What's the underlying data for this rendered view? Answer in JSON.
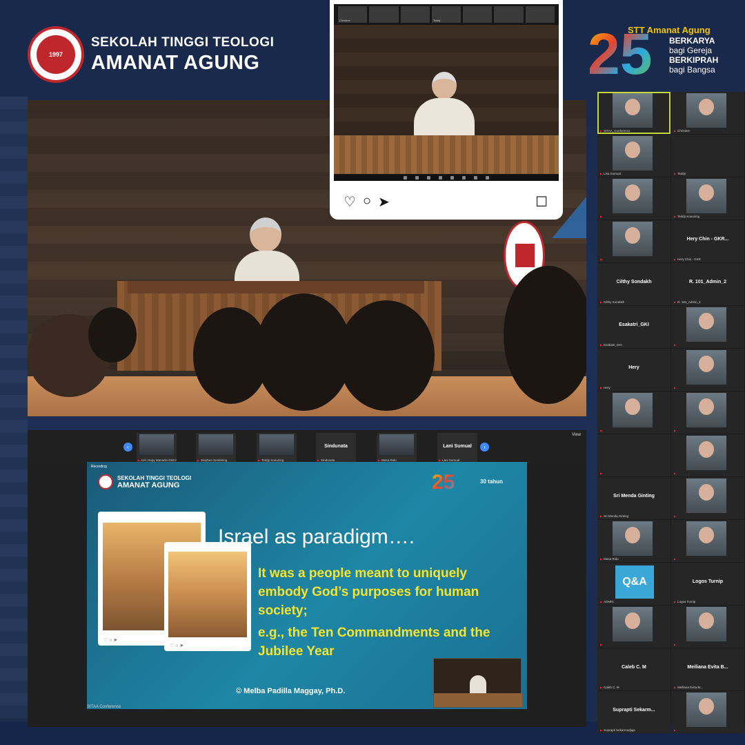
{
  "brand": {
    "line1": "SEKOLAH TINGGI TEOLOGI",
    "line2": "AMANAT AGUNG",
    "seal_year": "1997"
  },
  "anniversary": {
    "number": "25",
    "name": "STT Amanat Agung",
    "tag1": "BERKARYA",
    "tag2": "bagi Gereja",
    "tag3": "BERKIPRAH",
    "tag4": "bagi Bangsa"
  },
  "post_card": {
    "strip_names": [
      "Christine",
      "",
      "",
      "Teddy",
      "",
      "",
      ""
    ],
    "actions": {
      "like": "♡",
      "comment": "○",
      "share": "➤",
      "save": "☐"
    }
  },
  "gallery": [
    {
      "name": "",
      "tag": "SITAA_Conference",
      "video": true,
      "active": true
    },
    {
      "name": "",
      "tag": "Christine",
      "video": true
    },
    {
      "name": "",
      "tag": "Lisa Sumual",
      "video": true
    },
    {
      "name": "",
      "tag": "Teddy",
      "video": false
    },
    {
      "name": "",
      "tag": "",
      "video": true
    },
    {
      "name": "",
      "tag": "Teddy Koeuning",
      "video": true
    },
    {
      "name": "",
      "tag": "",
      "video": true
    },
    {
      "name": "Hery Chin - GKR...",
      "tag": "Hery Chin - GKR",
      "video": false
    },
    {
      "name": "Cilthy Sondakh",
      "tag": "Cilthy Sondakh",
      "video": false
    },
    {
      "name": "R. 101_Admin_2",
      "tag": "R. 101_Admin_2",
      "video": false
    },
    {
      "name": "Esakatri_GKI",
      "tag": "Esakatri_GKI",
      "video": false
    },
    {
      "name": "",
      "tag": "",
      "video": true
    },
    {
      "name": "Hery",
      "tag": "Hery",
      "video": false
    },
    {
      "name": "",
      "tag": "",
      "video": true
    },
    {
      "name": "",
      "tag": "",
      "video": true
    },
    {
      "name": "",
      "tag": "",
      "video": true
    },
    {
      "name": "",
      "tag": "",
      "video": false
    },
    {
      "name": "",
      "tag": "",
      "video": true
    },
    {
      "name": "Sri Menda Ginting",
      "tag": "Sri Menda Ginting",
      "video": false
    },
    {
      "name": "",
      "tag": "",
      "video": true
    },
    {
      "name": "",
      "tag": "Masa Rido",
      "video": true
    },
    {
      "name": "",
      "tag": "",
      "video": true
    },
    {
      "name": "",
      "tag": "ADMIN",
      "qa": "Q&A",
      "video": false
    },
    {
      "name": "Logos Turnip",
      "tag": "Logos Turnip",
      "video": false
    },
    {
      "name": "",
      "tag": "",
      "video": true
    },
    {
      "name": "",
      "tag": "",
      "video": true
    },
    {
      "name": "Caleb C. M",
      "tag": "Caleb C. M",
      "video": false
    },
    {
      "name": "Meiliana Evita B...",
      "tag": "Meiliana Evita Br...",
      "video": false
    },
    {
      "name": "Suprapti Sekarm...",
      "tag": "Suprapti Sekarmadjaja",
      "video": false
    },
    {
      "name": "",
      "tag": "",
      "video": true
    }
  ],
  "zoom_strip": [
    {
      "name": "",
      "tag": "Kel. Hepy Manacle-GMI N...",
      "video": true
    },
    {
      "name": "",
      "tag": "Stephen Sembiring",
      "video": true
    },
    {
      "name": "",
      "tag": "Teddy Koeuning",
      "video": true
    },
    {
      "name": "Sindunata",
      "tag": "Sindunata",
      "video": false
    },
    {
      "name": "",
      "tag": "Masa Rido",
      "video": true
    },
    {
      "name": "Lani Sumual",
      "tag": "Lani Sumual",
      "video": false
    }
  ],
  "zoom": {
    "view_label": "View",
    "conference": "SITAA Conference",
    "recording": "Recording",
    "prev": "‹",
    "next": "›"
  },
  "slide": {
    "brand1": "SEKOLAH TINGGI TEOLOGI",
    "brand2": "AMANAT AGUNG",
    "title": "Israel as paradigm….",
    "body": "It was a people meant to uniquely embody God’s purposes for human society;",
    "example": "e.g., the Ten Commandments and the Jubilee Year",
    "credit": "© Melba Padilla Maggay, Ph.D.",
    "logo_text": "30 tahun",
    "post_icons": "♡ ○ ➤"
  },
  "colors": {
    "accent": "#f5e52c",
    "brand_red": "#c0272d",
    "zoom_blue": "#3d8bfd",
    "active_border": "#c7d83a"
  }
}
